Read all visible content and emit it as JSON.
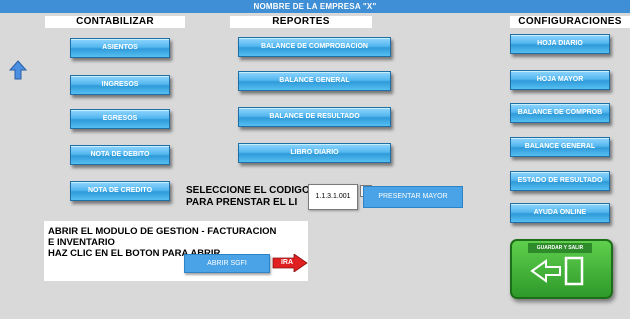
{
  "title": "NOMBRE DE LA EMPRESA \"X\"",
  "sections": {
    "contabilizar": "CONTABILIZAR",
    "reportes": "REPORTES",
    "configuraciones": "CONFIGURACIONES"
  },
  "contabilizar_buttons": [
    "ASIENTOS",
    "INGRESOS",
    "EGRESOS",
    "NOTA DE DEBITO",
    "NOTA DE CREDITO"
  ],
  "reportes_buttons": [
    "BALANCE DE COMPROBACION",
    "BALANCE GENERAL",
    "BALANCE  DE RESULTADO",
    "LIBRO DIARIO"
  ],
  "config_buttons": [
    "HOJA DIARIO",
    "HOJA MAYOR",
    "BALANCE DE COMPROB",
    "BALANCE GENERAL",
    "ESTADO DE RESULTADO",
    "AYUDA ONLINE"
  ],
  "selector": {
    "line1": "SELECCIONE EL CODIGO",
    "line2": "PARA PRENSTAR EL LI",
    "code_value": "1.1.3.1.001",
    "button": "PRESENTAR MAYOR"
  },
  "sgfi": {
    "line1": "ABRIR EL MODULO DE GESTION - FACTURACION",
    "line2": "E INVENTARIO",
    "line3": "HAZ CLIC EN EL BOTON PARA ABRIR",
    "button": "ABRIR SGFI",
    "arrow_label": "IRA"
  },
  "save": {
    "label": "GUARDAR Y SALIR"
  },
  "colors": {
    "topbar": "#3f8fd6",
    "button": "#54b7ef",
    "save": "#3db236",
    "arrow": "#e02020"
  }
}
